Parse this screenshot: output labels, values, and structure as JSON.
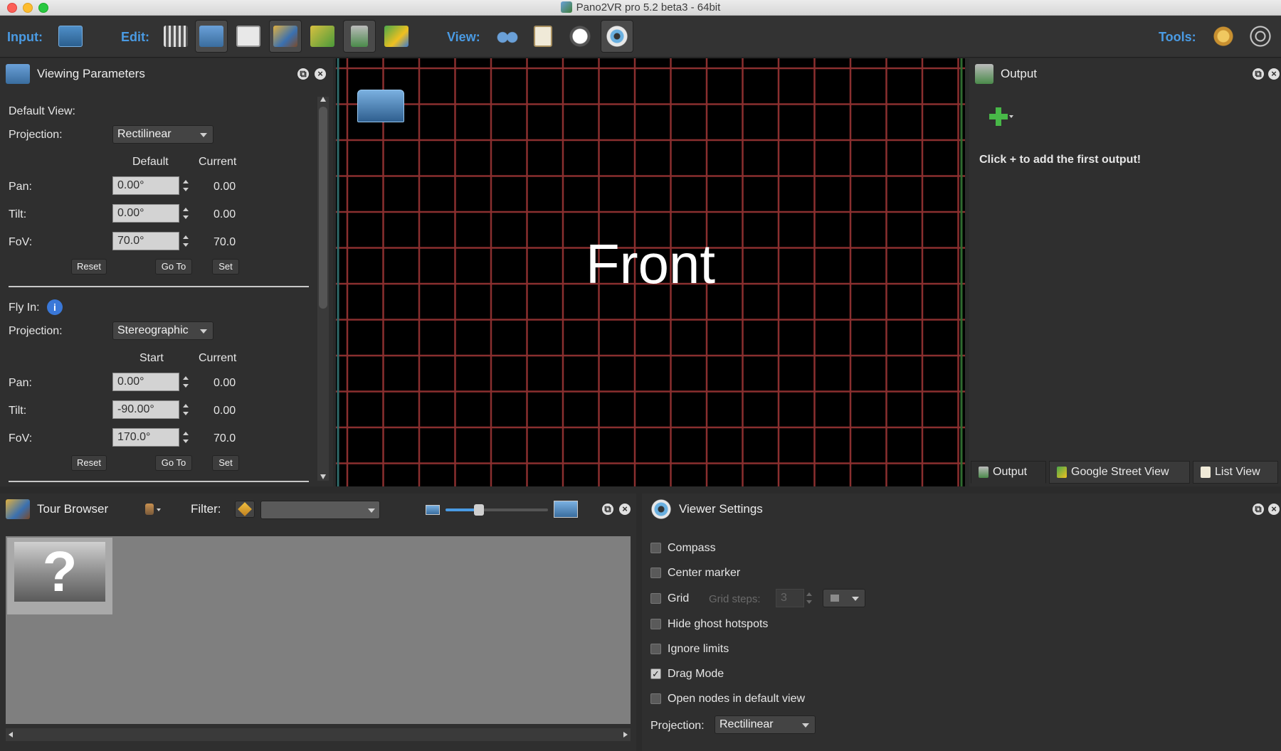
{
  "window": {
    "title": "Pano2VR pro 5.2 beta3 - 64bit"
  },
  "toolbar": {
    "input_label": "Input:",
    "edit_label": "Edit:",
    "view_label": "View:",
    "tools_label": "Tools:"
  },
  "viewing_parameters": {
    "title": "Viewing Parameters",
    "default_view": {
      "heading": "Default View:",
      "projection_label": "Projection:",
      "projection_value": "Rectilinear",
      "col_default": "Default",
      "col_current": "Current",
      "rows": [
        {
          "label": "Pan:",
          "value": "0.00°",
          "current": "0.00"
        },
        {
          "label": "Tilt:",
          "value": "0.00°",
          "current": "0.00"
        },
        {
          "label": "FoV:",
          "value": "70.0°",
          "current": "70.0"
        }
      ],
      "reset": "Reset",
      "goto": "Go To",
      "set": "Set"
    },
    "fly_in": {
      "heading": "Fly In:",
      "projection_label": "Projection:",
      "projection_value": "Stereographic",
      "col_start": "Start",
      "col_current": "Current",
      "rows": [
        {
          "label": "Pan:",
          "value": "0.00°",
          "current": "0.00"
        },
        {
          "label": "Tilt:",
          "value": "-90.00°",
          "current": "0.00"
        },
        {
          "label": "FoV:",
          "value": "170.0°",
          "current": "70.0"
        }
      ],
      "reset": "Reset",
      "goto": "Go To",
      "set": "Set"
    }
  },
  "viewport": {
    "face_label": "Front"
  },
  "output": {
    "title": "Output",
    "empty_message": "Click + to add the first output!",
    "tabs": [
      "Output",
      "Google Street View",
      "List View"
    ]
  },
  "tour_browser": {
    "title": "Tour Browser",
    "filter_label": "Filter:",
    "thumb_zoom": 0.15
  },
  "viewer_settings": {
    "title": "Viewer Settings",
    "options": [
      {
        "label": "Compass",
        "checked": false
      },
      {
        "label": "Center marker",
        "checked": false
      },
      {
        "label": "Grid",
        "checked": false
      },
      {
        "label": "Hide ghost hotspots",
        "checked": false
      },
      {
        "label": "Ignore limits",
        "checked": false
      },
      {
        "label": "Drag Mode",
        "checked": true
      },
      {
        "label": "Open nodes in default view",
        "checked": false
      }
    ],
    "grid_steps_label": "Grid steps:",
    "grid_steps_value": "3",
    "projection_label": "Projection:",
    "projection_value": "Rectilinear"
  },
  "colors": {
    "accent": "#4a9be4",
    "grid_line": "#8a2f2f",
    "grid_edge_left": "#2f6a6a",
    "grid_edge_right": "#2f6a2f",
    "add_green": "#48b848"
  }
}
